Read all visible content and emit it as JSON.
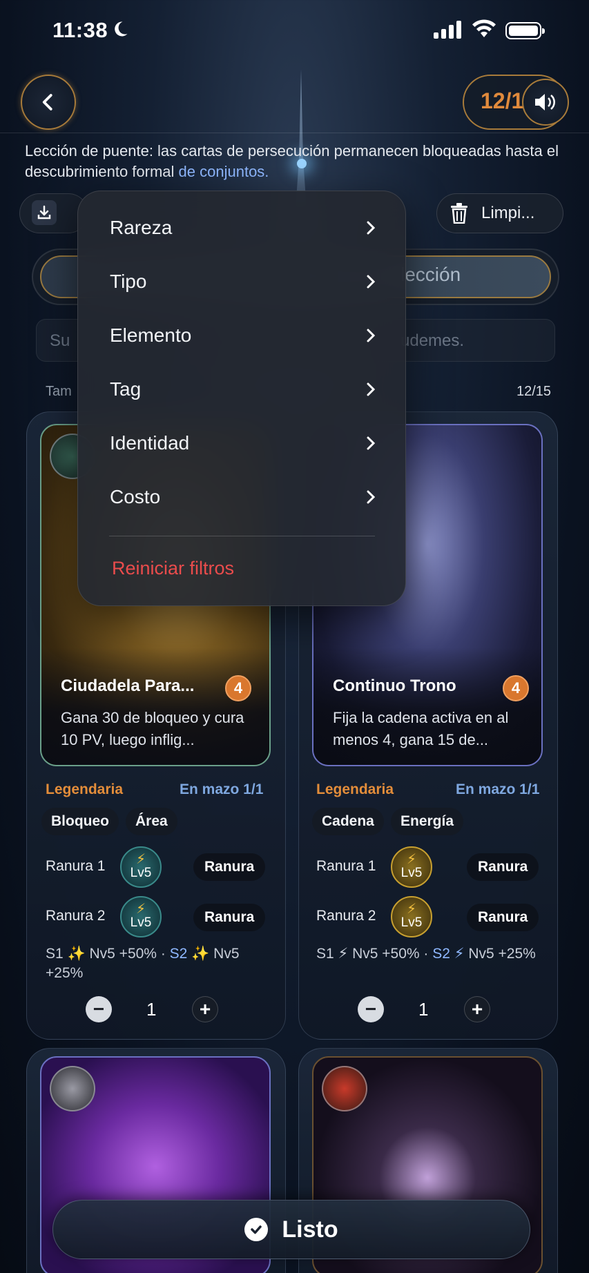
{
  "status": {
    "time": "11:38"
  },
  "header": {
    "counter": "12/1"
  },
  "lesson": {
    "text": "Lección de puente: las cartas de persecución permanecen bloqueadas hasta el descubrimiento formal ",
    "link": "de conjuntos."
  },
  "toolbar": {
    "clear_label": "Limpi..."
  },
  "collection": {
    "label": "lección"
  },
  "search": {
    "placeholder_left": "Su",
    "placeholder_right": "udemes."
  },
  "size": {
    "label": "Tam",
    "count": "12/15"
  },
  "filter_menu": {
    "items": [
      {
        "label": "Rareza"
      },
      {
        "label": "Tipo"
      },
      {
        "label": "Elemento"
      },
      {
        "label": "Tag"
      },
      {
        "label": "Identidad"
      },
      {
        "label": "Costo"
      }
    ],
    "reset_label": "Reiniciar filtros"
  },
  "cards": [
    {
      "title": "Ciudadela Para...",
      "cost": "4",
      "desc": "Gana 30 de bloqueo y cura 10 PV, luego inflig...",
      "rarity": "Legendaria",
      "in_deck": "En mazo 1/1",
      "tags": [
        "Bloqueo",
        "Área"
      ],
      "slots": [
        {
          "label": "Ranura 1",
          "level": "Lv5",
          "button": "Ranura"
        },
        {
          "label": "Ranura 2",
          "level": "Lv5",
          "button": "Ranura"
        }
      ],
      "skill_s1": "S1 ✨ Nv5 +50%",
      "skill_s2": "S2 ✨",
      "skill_s2_rest": "Nv5 +25%",
      "quantity": "1"
    },
    {
      "title": "Continuo Trono",
      "cost": "4",
      "desc": "Fija la cadena activa en al menos 4, gana 15 de...",
      "rarity": "Legendaria",
      "in_deck": "En mazo 1/1",
      "tags": [
        "Cadena",
        "Energía"
      ],
      "slots": [
        {
          "label": "Ranura 1",
          "level": "Lv5",
          "button": "Ranura"
        },
        {
          "label": "Ranura 2",
          "level": "Lv5",
          "button": "Ranura"
        }
      ],
      "skill_s1": "S1 ⚡ Nv5 +50%",
      "skill_s2": "S2 ⚡",
      "skill_s2_rest": "Nv5 +25%",
      "quantity": "1"
    }
  ],
  "done_button": {
    "label": "Listo"
  },
  "colors": {
    "accent_orange": "#e38d3a",
    "link_blue": "#8fb8ff",
    "danger_red": "#ea4c4c",
    "frame_gold": "#a87b3a"
  }
}
